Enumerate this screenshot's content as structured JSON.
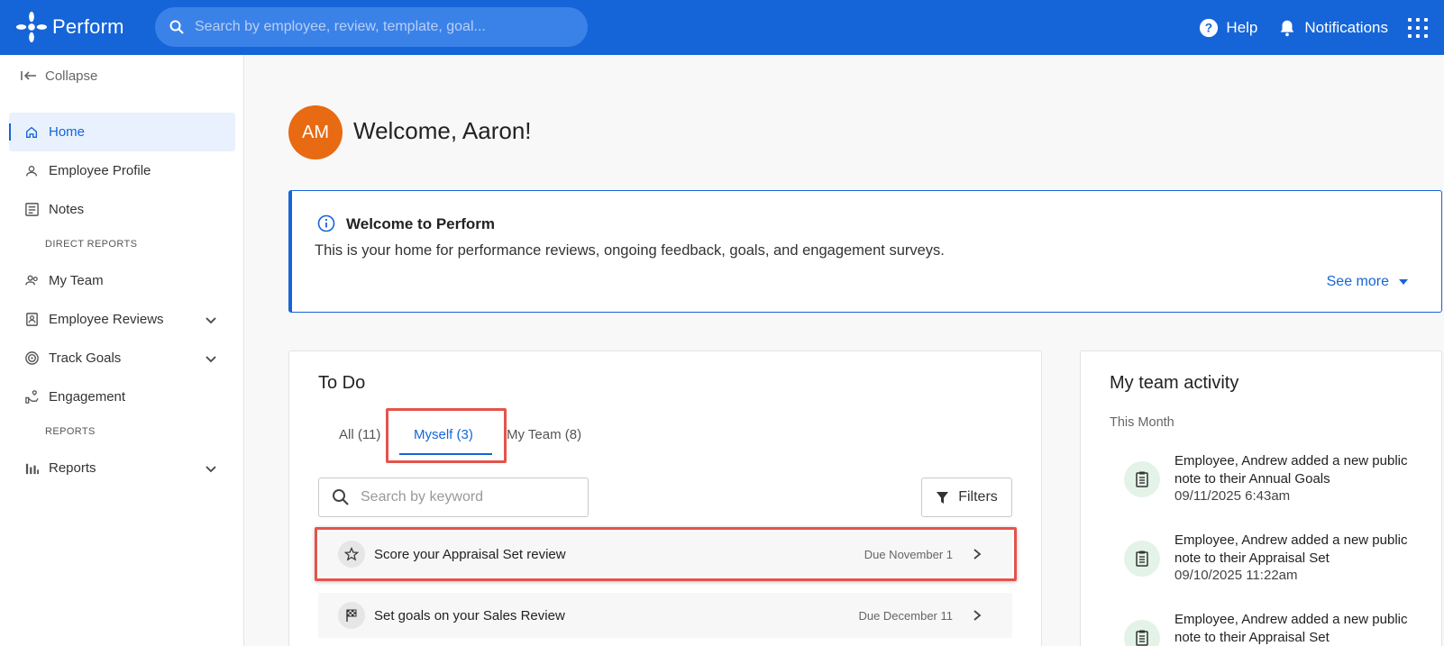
{
  "app": {
    "name": "Perform",
    "brand_color": "#1565d8",
    "highlight_color": "#e5534b"
  },
  "header": {
    "search_placeholder": "Search by employee, review, template, goal...",
    "help_label": "Help",
    "notifications_label": "Notifications"
  },
  "sidebar": {
    "collapse_label": "Collapse",
    "items": [
      {
        "label": "Home",
        "icon": "home-icon",
        "active": true
      },
      {
        "label": "Employee Profile",
        "icon": "person-icon"
      },
      {
        "label": "Notes",
        "icon": "notes-icon"
      },
      {
        "label": "My Team",
        "icon": "team-icon"
      },
      {
        "label": "Employee Reviews",
        "icon": "review-icon",
        "expandable": true
      },
      {
        "label": "Track Goals",
        "icon": "target-icon",
        "expandable": true
      },
      {
        "label": "Engagement",
        "icon": "engagement-icon"
      },
      {
        "label": "Reports",
        "icon": "bar-chart-icon",
        "expandable": true
      }
    ],
    "sections": {
      "direct_reports": "DIRECT REPORTS",
      "reports": "REPORTS"
    }
  },
  "main": {
    "avatar_initials": "AM",
    "avatar_color": "#e86a12",
    "welcome": "Welcome, Aaron!",
    "banner": {
      "title": "Welcome to Perform",
      "body": "This is your home for performance reviews, ongoing feedback, goals, and engagement surveys.",
      "see_more": "See more"
    },
    "todo": {
      "title": "To Do",
      "tabs": [
        {
          "label": "All (11)"
        },
        {
          "label": "Myself (3)",
          "active": true
        },
        {
          "label": "My Team (8)"
        }
      ],
      "search_placeholder": "Search by keyword",
      "filters_label": "Filters",
      "items": [
        {
          "text": "Score your Appraisal Set review",
          "due": "Due November 1",
          "icon": "star-icon"
        },
        {
          "text": "Set goals on your Sales Review",
          "due": "Due December 11",
          "icon": "flag-icon"
        }
      ]
    },
    "team_activity": {
      "title": "My team activity",
      "period": "This Month",
      "items": [
        {
          "text": "Employee, Andrew added a new public note to their Annual Goals",
          "time": "09/11/2025 6:43am"
        },
        {
          "text": "Employee, Andrew added a new public note to their Appraisal Set",
          "time": "09/10/2025 11:22am"
        },
        {
          "text": "Employee, Andrew added a new public note to their Appraisal Set",
          "time": ""
        }
      ]
    }
  }
}
